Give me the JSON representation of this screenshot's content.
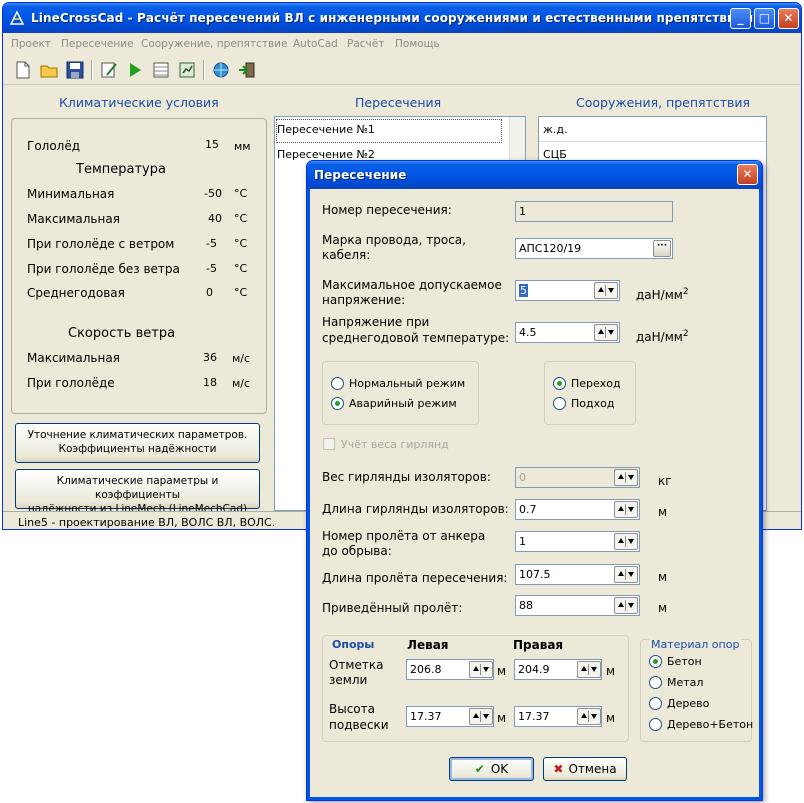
{
  "app": {
    "title": "LineCrossCad - Расчёт пересечений ВЛ с инженерными сооружениями и естественными препятствиями",
    "window_buttons": {
      "minimize": "_",
      "maximize": "□",
      "close": "✕"
    }
  },
  "menu": [
    "Проект",
    "Пересечение",
    "Сооружение, препятствие",
    "AutoCad",
    "Расчёт",
    "Помощь"
  ],
  "toolbar": [
    "new-file-icon",
    "open-folder-icon",
    "save-disk-icon",
    "edit-icon",
    "run-icon",
    "table-icon",
    "report-icon",
    "globe-icon",
    "exit-icon"
  ],
  "climate": {
    "header": "Климатические условия",
    "ice": {
      "label": "Гололёд",
      "value": "15",
      "unit": "мм"
    },
    "temperature_title": "Температура",
    "temperatures": [
      {
        "label": "Минимальная",
        "value": "-50",
        "unit": "°С"
      },
      {
        "label": "Максимальная",
        "value": "40",
        "unit": "°С"
      },
      {
        "label": "При гололёде с ветром",
        "value": "-5",
        "unit": "°С"
      },
      {
        "label": "При гололёде без ветра",
        "value": "-5",
        "unit": "°С"
      },
      {
        "label": "Среднегодовая",
        "value": "0",
        "unit": "°С"
      }
    ],
    "wind_title": "Скорость ветра",
    "wind": [
      {
        "label": "Максимальная",
        "value": "36",
        "unit": "м/с"
      },
      {
        "label": "При гололёде",
        "value": "18",
        "unit": "м/с"
      }
    ],
    "refine_button": [
      "Уточнение климатических параметров.",
      "Коэффициенты надёжности"
    ],
    "import_button": [
      "Климатические параметры и коэффициенты",
      "надёжности из LineMech (LineMechCad)"
    ]
  },
  "crossings": {
    "header": "Пересечения",
    "items": [
      "Пересечение №1",
      "Пересечение №2"
    ]
  },
  "structures": {
    "header": "Сооружения, препятствия",
    "items": [
      "ж.д.",
      "СЦБ"
    ]
  },
  "status": "Line5 - проектирование ВЛ, ВОЛС ВЛ, ВОЛС.",
  "dialog": {
    "title": "Пересечение",
    "close": "✕",
    "crossing_number": {
      "label": "Номер пересечения:",
      "value": "1"
    },
    "wire_grade": {
      "label": [
        "Марка провода, троса,",
        "кабеля:"
      ],
      "value": "АПС120/19",
      "button": "···"
    },
    "max_stress": {
      "label": [
        "Максимальное допускаемое",
        "напряжение:"
      ],
      "value": "5",
      "unit": "даН/мм",
      "unit_sup": "2"
    },
    "avg_stress": {
      "label": [
        "Напряжение при",
        "среднегодовой температуре:"
      ],
      "value": "4.5",
      "unit": "даН/мм",
      "unit_sup": "2"
    },
    "mode": [
      {
        "label": "Нормальный режим",
        "checked": false
      },
      {
        "label": "Аварийный режим",
        "checked": true
      }
    ],
    "transition": [
      {
        "label": "Переход",
        "checked": true
      },
      {
        "label": "Подход",
        "checked": false
      }
    ],
    "string_weight_check": {
      "label": "Учёт веса гирлянд",
      "checked": false
    },
    "insulator_weight": {
      "label": "Вес гирлянды изоляторов:",
      "value": "0",
      "unit": "кг"
    },
    "insulator_length": {
      "label": "Длина гирлянды изоляторов:",
      "value": "0.7",
      "unit": "м"
    },
    "span_number": {
      "label": [
        "Номер пролёта от анкера",
        "до обрыва:"
      ],
      "value": "1"
    },
    "span_length": {
      "label": "Длина пролёта пересечения:",
      "value": "107.5",
      "unit": "м"
    },
    "reduced_span": {
      "label": "Приведённый пролёт:",
      "value": "88",
      "unit": "м"
    },
    "supports": {
      "title": "Опоры",
      "left_header": "Левая",
      "right_header": "Правая",
      "ground_label": [
        "Отметка",
        "земли"
      ],
      "ground_left": "206.8",
      "ground_right": "204.9",
      "height_label": [
        "Высота",
        "подвески"
      ],
      "height_left": "17.37",
      "height_right": "17.37",
      "unit": "м"
    },
    "material": {
      "title": "Материал опор",
      "options": [
        {
          "label": "Бетон",
          "checked": true
        },
        {
          "label": "Метал",
          "checked": false
        },
        {
          "label": "Дерево",
          "checked": false
        },
        {
          "label": "Дерево+Бетон",
          "checked": false
        }
      ]
    },
    "ok": "OK",
    "cancel": "Отмена"
  }
}
